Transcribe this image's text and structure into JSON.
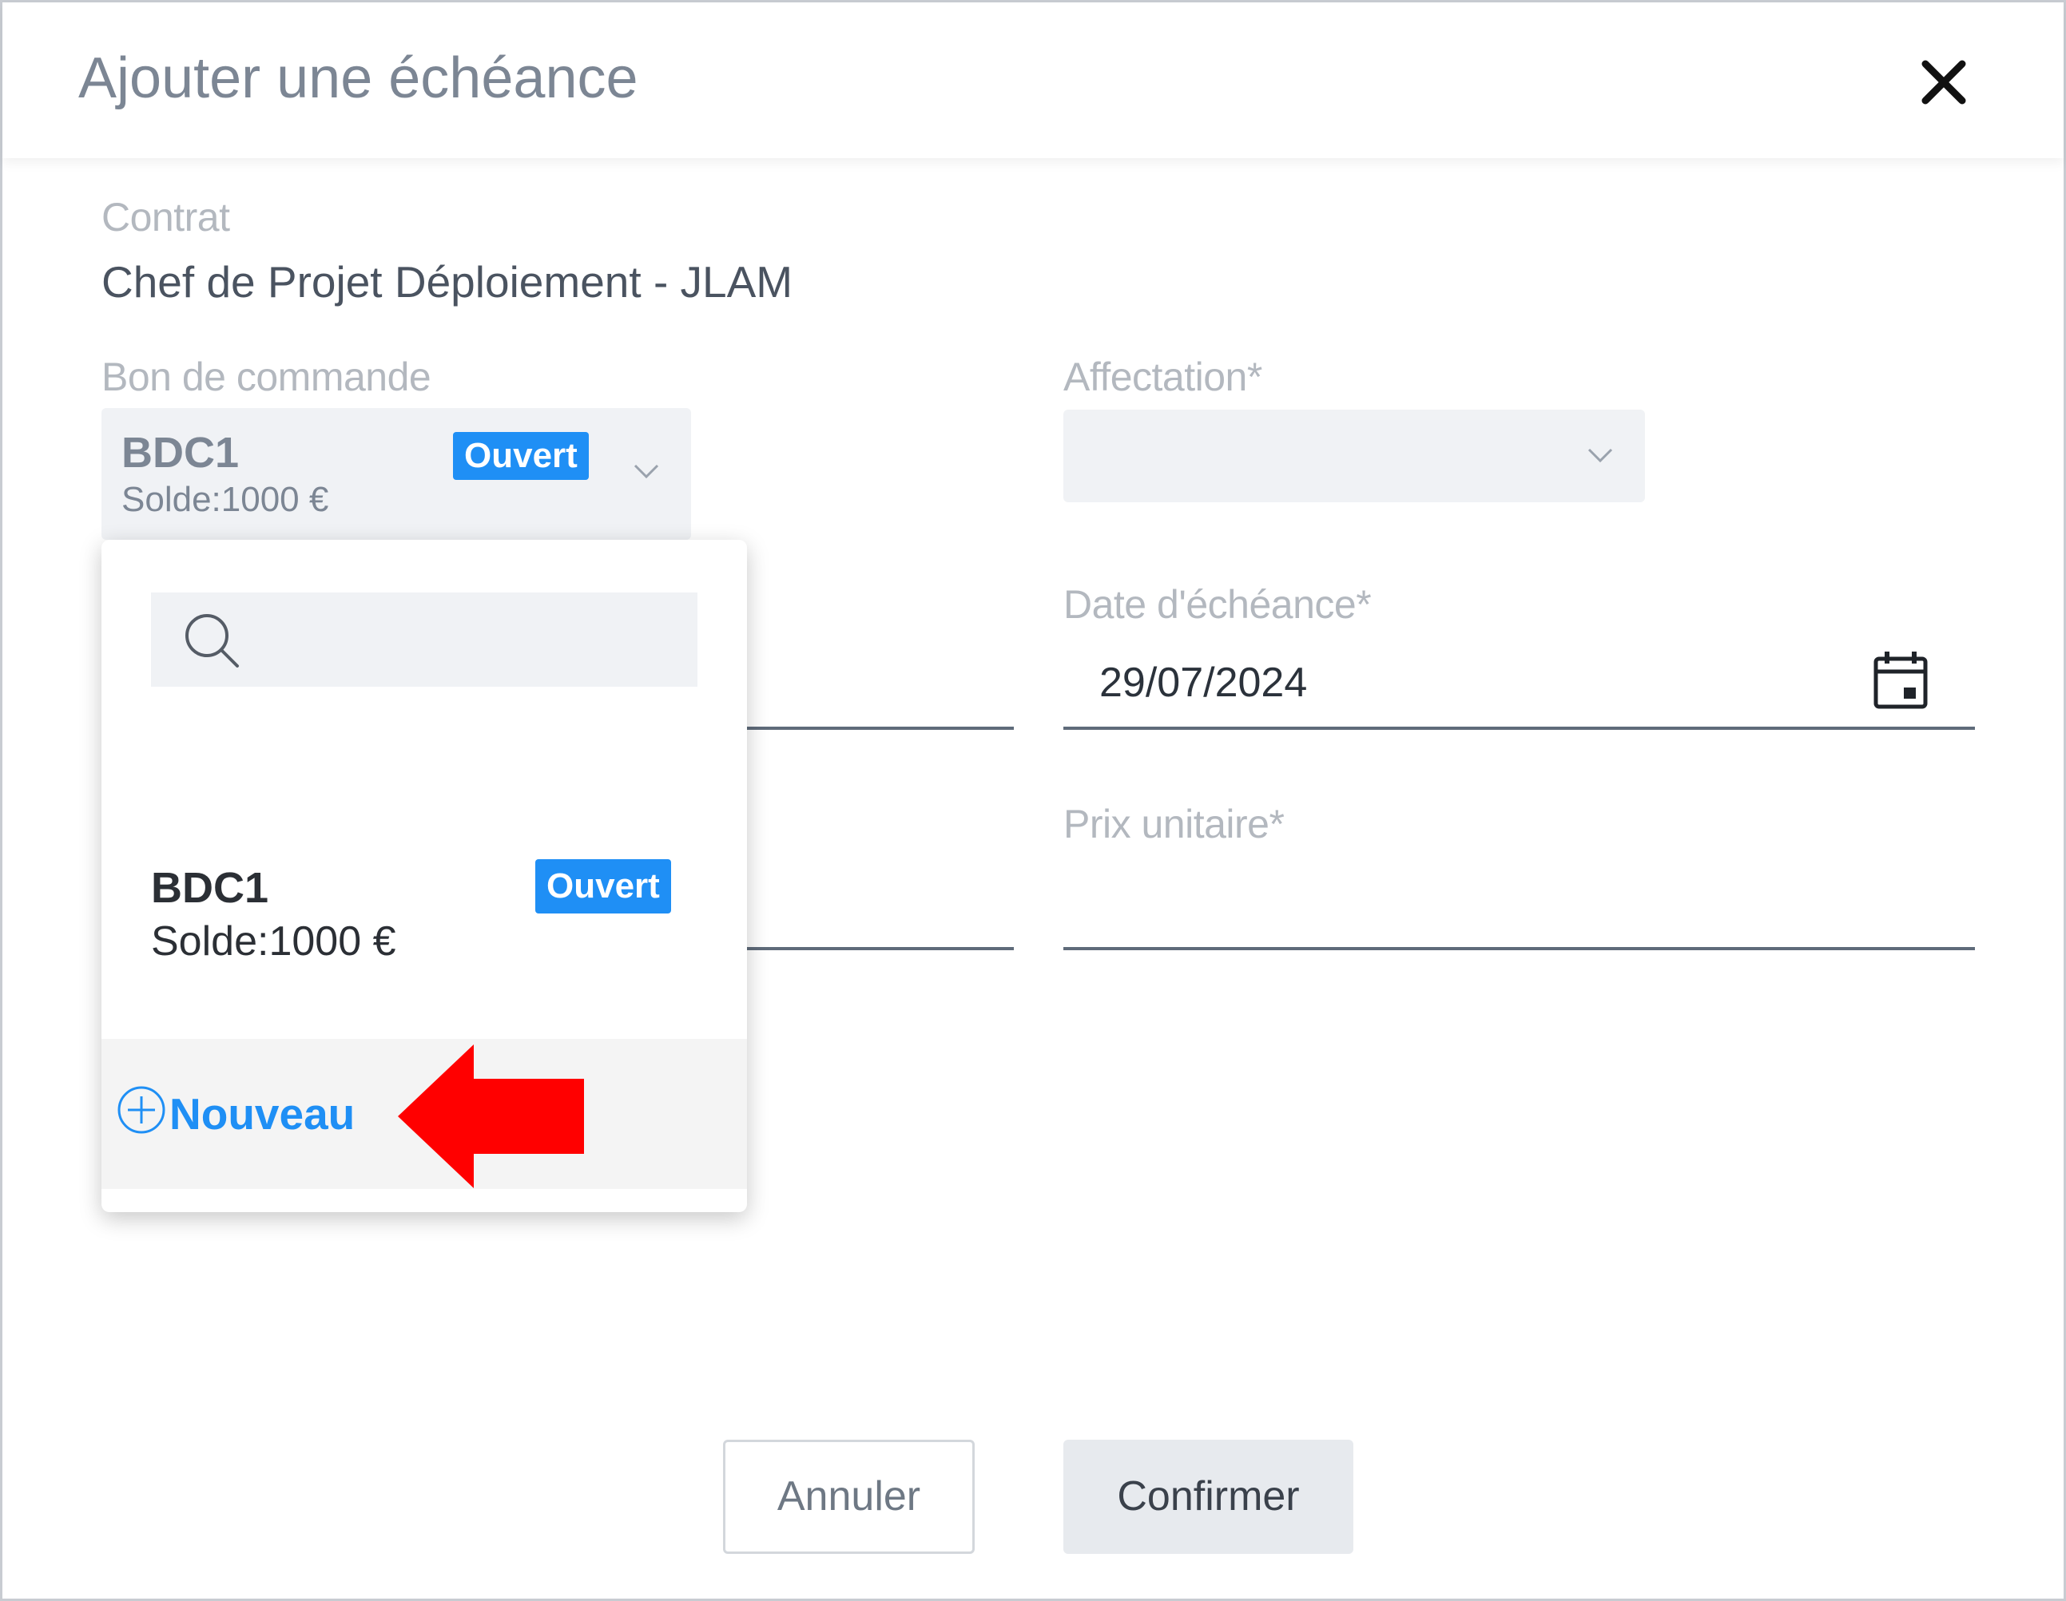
{
  "dialog": {
    "title": "Ajouter une échéance",
    "close_icon": "close-icon"
  },
  "contract": {
    "label": "Contrat",
    "value": "Chef de Projet Déploiement - JLAM"
  },
  "order": {
    "label": "Bon de commande",
    "selected_name": "BDC1",
    "selected_badge": "Ouvert",
    "selected_balance": "Solde:1000 €",
    "chevron_icon": "chevron-down-icon"
  },
  "assignment": {
    "label": "Affectation*",
    "value": "",
    "chevron_icon": "chevron-down-icon"
  },
  "due_date": {
    "label": "Date d'échéance*",
    "value": "29/07/2024",
    "calendar_icon": "calendar-icon"
  },
  "unit_price": {
    "label": "Prix unitaire*",
    "value": ""
  },
  "dropdown": {
    "search_placeholder": "",
    "search_icon": "search-icon",
    "options": [
      {
        "name": "BDC1",
        "badge": "Ouvert",
        "balance": "Solde:1000 €"
      }
    ],
    "new_label": "Nouveau",
    "new_icon": "plus-circle-icon",
    "annotation_icon": "red-arrow-icon"
  },
  "footer": {
    "cancel_label": "Annuler",
    "confirm_label": "Confirmer"
  },
  "colors": {
    "accent": "#1f8ff5",
    "badge_bg": "#1f8ff5",
    "annotation_arrow": "#ff0000",
    "field_bg": "#f0f2f5"
  }
}
